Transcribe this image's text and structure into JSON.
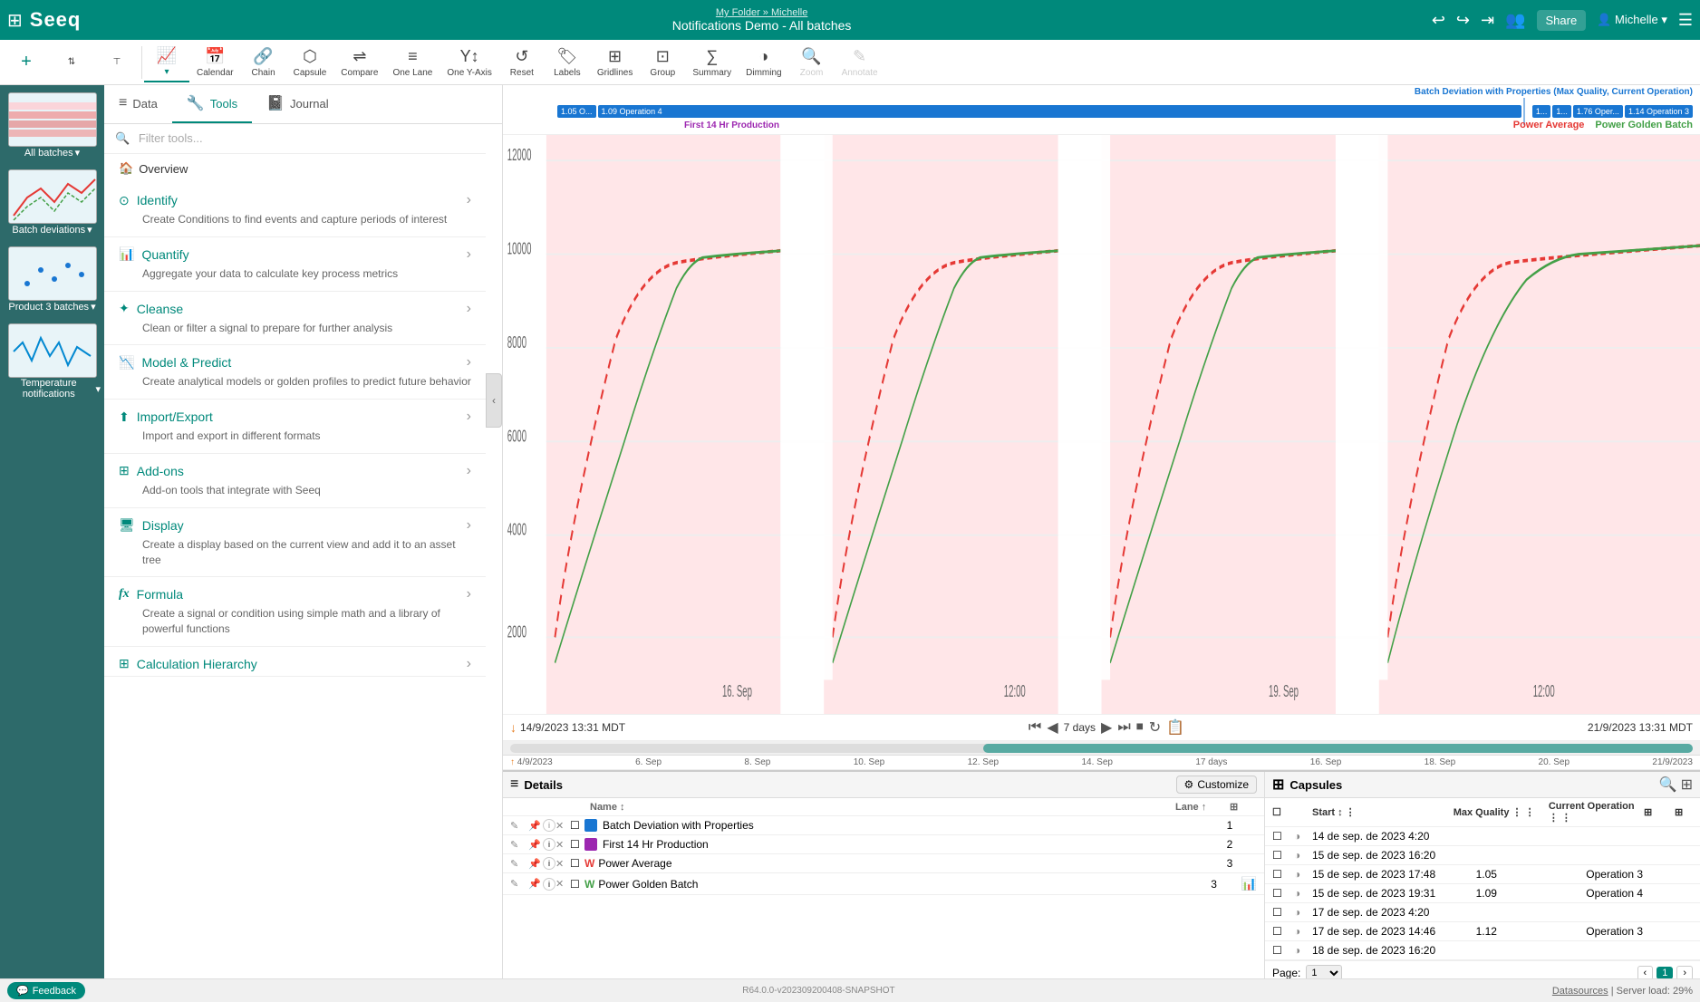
{
  "app": {
    "logo": "Seeq",
    "breadcrumb": "My Folder » Michelle",
    "title": "Notifications Demo - All batches",
    "share_label": "Share",
    "user": "Michelle"
  },
  "toolbar": {
    "items": [
      {
        "id": "trend",
        "label": "Trend",
        "icon": "📈",
        "active": true
      },
      {
        "id": "calendar",
        "label": "Calendar",
        "icon": "📅",
        "active": false
      },
      {
        "id": "chain",
        "label": "Chain",
        "icon": "🔗",
        "active": false
      },
      {
        "id": "capsule",
        "label": "Capsule",
        "icon": "💊",
        "active": false
      },
      {
        "id": "compare",
        "label": "Compare",
        "icon": "⚖️",
        "active": false
      },
      {
        "id": "one-lane",
        "label": "One Lane",
        "icon": "≡",
        "active": false
      },
      {
        "id": "one-y",
        "label": "One Y-Axis",
        "icon": "Y",
        "active": false
      },
      {
        "id": "reset",
        "label": "Reset",
        "icon": "↺",
        "active": false
      },
      {
        "id": "labels",
        "label": "Labels",
        "icon": "🏷️",
        "active": false
      },
      {
        "id": "gridlines",
        "label": "Gridlines",
        "icon": "⊞",
        "active": false
      },
      {
        "id": "group",
        "label": "Group",
        "icon": "⊡",
        "active": false
      },
      {
        "id": "summary",
        "label": "Summary",
        "icon": "∑",
        "active": false
      },
      {
        "id": "dimming",
        "label": "Dimming",
        "icon": "◑",
        "active": false
      },
      {
        "id": "zoom",
        "label": "Zoom",
        "icon": "🔍",
        "active": false
      },
      {
        "id": "annotate",
        "label": "Annotate",
        "icon": "✎",
        "active": false
      }
    ]
  },
  "tools_panel": {
    "tabs": [
      {
        "id": "data",
        "label": "Data",
        "icon": "≡",
        "active": false
      },
      {
        "id": "tools",
        "label": "Tools",
        "icon": "🔧",
        "active": true
      },
      {
        "id": "journal",
        "label": "Journal",
        "icon": "📓",
        "active": false
      }
    ],
    "search_placeholder": "Filter tools...",
    "overview_label": "Overview",
    "items": [
      {
        "id": "identify",
        "title": "Identify",
        "icon": "⊙",
        "desc": "Create Conditions to find events and capture periods of interest"
      },
      {
        "id": "quantify",
        "title": "Quantify",
        "icon": "📊",
        "desc": "Aggregate your data to calculate key process metrics"
      },
      {
        "id": "cleanse",
        "title": "Cleanse",
        "icon": "✦",
        "desc": "Clean or filter a signal to prepare for further analysis"
      },
      {
        "id": "model-predict",
        "title": "Model & Predict",
        "icon": "📉",
        "desc": "Create analytical models or golden profiles to predict future behavior"
      },
      {
        "id": "import-export",
        "title": "Import/Export",
        "icon": "⬆",
        "desc": "Import and export in different formats"
      },
      {
        "id": "add-ons",
        "title": "Add-ons",
        "icon": "⊞",
        "desc": "Add-on tools that integrate with Seeq"
      },
      {
        "id": "display",
        "title": "Display",
        "icon": "🖥",
        "desc": "Create a display based on the current view and add it to an asset tree"
      },
      {
        "id": "formula",
        "title": "Formula",
        "icon": "fx",
        "desc": "Create a signal or condition using simple math and a library of powerful functions"
      },
      {
        "id": "calc-hierarchy",
        "title": "Calculation Hierarchy",
        "icon": "⊞",
        "desc": ""
      }
    ]
  },
  "chart": {
    "left_timestamp": "14/9/2023 13:31 MDT",
    "right_timestamp": "21/9/2023 13:31 MDT",
    "duration": "7 days",
    "start_full": "4/9/2023",
    "end_full": "21/9/2023",
    "full_duration": "17 days",
    "y_labels": [
      "12000",
      "10000",
      "8000",
      "6000",
      "4000",
      "2000"
    ],
    "x_labels": [
      "16. Sep",
      "12:00",
      "19. Sep",
      "12:00"
    ],
    "timeline_labels": [
      "6. Sep",
      "8. Sep",
      "10. Sep",
      "12. Sep",
      "14. Sep",
      "16. Sep",
      "18. Sep",
      "20. Sep"
    ],
    "legend": {
      "items": [
        {
          "label": "Power Average",
          "color": "#e53935"
        },
        {
          "label": "Power Golden Batch",
          "color": "#43a047"
        }
      ]
    },
    "batch_labels": [
      {
        "text": "1.05 O...",
        "wide": false
      },
      {
        "text": "1.09 Operation 4",
        "wide": true
      },
      {
        "text": "1...",
        "wide": false
      },
      {
        "text": "1...",
        "wide": false
      },
      {
        "text": "1.76 Oper...",
        "wide": false
      },
      {
        "text": "1.14 Operation 3",
        "wide": false
      }
    ],
    "top_label": "Batch Deviation with Properties (Max Quality, Current Operation)",
    "prod_label": "First 14 Hr Production"
  },
  "details": {
    "title": "Details",
    "customize_label": "Customize",
    "cols": [
      "Name",
      "Lane"
    ],
    "rows": [
      {
        "color": "#1976d2",
        "name": "Batch Deviation with Properties",
        "lane": "1",
        "type": "capsule"
      },
      {
        "color": "#9c27b0",
        "name": "First 14 Hr Production",
        "lane": "2",
        "type": "capsule"
      },
      {
        "color": "#e53935",
        "name": "Power Average",
        "lane": "3",
        "type": "signal"
      },
      {
        "color": "#43a047",
        "name": "Power Golden Batch",
        "lane": "3",
        "type": "signal"
      }
    ]
  },
  "capsules": {
    "title": "Capsules",
    "cols": [
      "Start",
      "Max Quality",
      "Current Operation"
    ],
    "rows": [
      {
        "start": "14 de sep. de 2023 4:20",
        "max_quality": "",
        "current_op": "",
        "checked": false
      },
      {
        "start": "15 de sep. de 2023 16:20",
        "max_quality": "",
        "current_op": "",
        "checked": false
      },
      {
        "start": "15 de sep. de 2023 17:48",
        "max_quality": "1.05",
        "current_op": "Operation 3",
        "checked": false
      },
      {
        "start": "15 de sep. de 2023 19:31",
        "max_quality": "1.09",
        "current_op": "Operation 4",
        "checked": false
      },
      {
        "start": "17 de sep. de 2023 4:20",
        "max_quality": "",
        "current_op": "",
        "checked": false
      },
      {
        "start": "17 de sep. de 2023 14:46",
        "max_quality": "1.12",
        "current_op": "Operation 3",
        "checked": false
      },
      {
        "start": "18 de sep. de 2023 16:20",
        "max_quality": "",
        "current_op": "",
        "checked": false
      }
    ],
    "page_label": "Page:",
    "page_num": "1",
    "page_total": "1"
  },
  "footer": {
    "feedback": "Feedback",
    "version": "R64.0.0-v202309200408-SNAPSHOT",
    "datasources": "Datasources",
    "server_load": "Server load: 29%"
  },
  "sidebar": {
    "items": [
      {
        "label": "All batches",
        "thumb_type": "heatmap"
      },
      {
        "label": "Batch deviations",
        "thumb_type": "line"
      },
      {
        "label": "Product 3 batches",
        "thumb_type": "scatter"
      },
      {
        "label": "Temperature notifications",
        "thumb_type": "wave"
      }
    ]
  }
}
